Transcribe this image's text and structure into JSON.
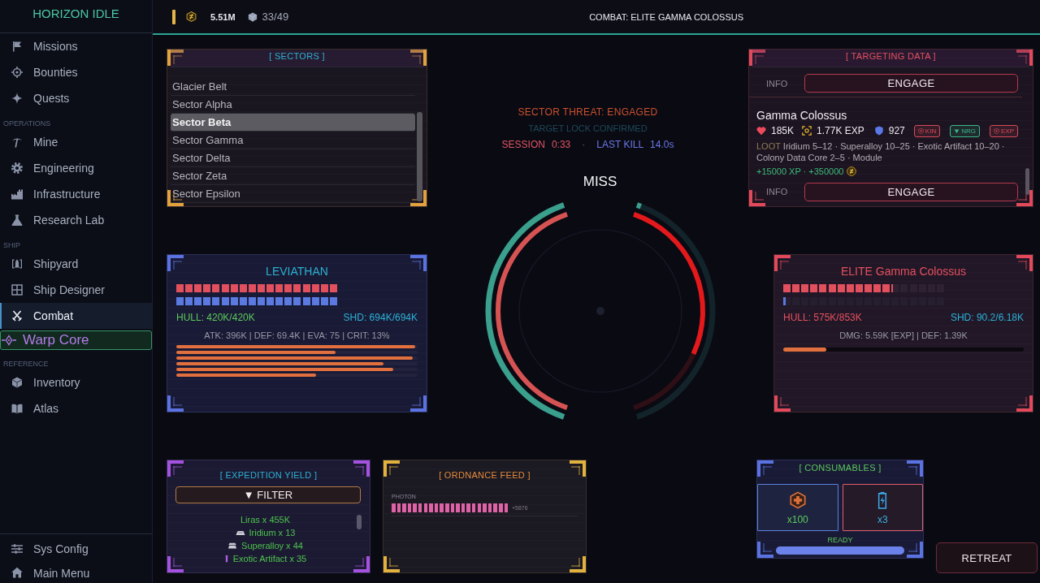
{
  "sidebar": {
    "title": "HORIZON IDLE",
    "sections": [
      {
        "items": [
          {
            "label": "Missions",
            "kind": "nav",
            "selected": false
          },
          {
            "label": "Bounties",
            "kind": "nav",
            "selected": false
          },
          {
            "label": "Quests",
            "kind": "nav",
            "selected": false
          }
        ]
      },
      {
        "heading": "OPERATIONS",
        "items": [
          {
            "label": "Mine",
            "kind": "nav",
            "selected": false
          },
          {
            "label": "Engineering",
            "kind": "nav",
            "selected": false
          },
          {
            "label": "Infrastructure",
            "kind": "nav",
            "selected": false
          },
          {
            "label": "Research Lab",
            "kind": "nav",
            "selected": false
          }
        ]
      },
      {
        "heading": "SHIP",
        "items": [
          {
            "label": "Shipyard",
            "kind": "nav",
            "selected": false
          },
          {
            "label": "Ship Designer",
            "kind": "nav",
            "selected": false
          },
          {
            "label": "Combat",
            "kind": "nav",
            "selected": true
          },
          {
            "label": "Warp Core",
            "kind": "featured",
            "selected": false
          }
        ]
      },
      {
        "heading": "REFERENCE",
        "items": [
          {
            "label": "Inventory",
            "kind": "nav",
            "selected": false
          },
          {
            "label": "Atlas",
            "kind": "nav",
            "selected": false
          }
        ]
      }
    ],
    "footer": [
      {
        "label": "Sys Config",
        "selected": false
      },
      {
        "label": "Main Menu",
        "selected": false
      }
    ]
  },
  "topbar": {
    "credits": "5.51M",
    "cargo": "33/49",
    "title": "COMBAT: ELITE GAMMA COLOSSUS"
  },
  "sectors": {
    "title": "[ SECTORS ]",
    "items": [
      {
        "label": "Glacier Belt",
        "selected": false
      },
      {
        "label": "Sector Alpha",
        "selected": false
      },
      {
        "label": "Sector Beta",
        "selected": true
      },
      {
        "label": "Sector Gamma",
        "selected": false
      },
      {
        "label": "Sector Delta",
        "selected": false
      },
      {
        "label": "Sector Zeta",
        "selected": false
      },
      {
        "label": "Sector Epsilon",
        "selected": false
      }
    ]
  },
  "status": {
    "threat": "SECTOR THREAT: ENGAGED",
    "lock": "TARGET LOCK CONFIRMED",
    "stats": [
      {
        "label": "SESSION",
        "value": "0:33",
        "color": "#e05565"
      },
      {
        "label": "LAST KILL",
        "value": "14.0s",
        "color": "#6a78e6"
      }
    ],
    "separator": "·",
    "result": "MISS"
  },
  "targeting": {
    "title": "[ TARGETING DATA ]",
    "rows": [
      {
        "kind": "actions",
        "info": "INFO",
        "button": "ENGAGE"
      },
      {
        "kind": "target",
        "name": "Gamma Colossus",
        "hp": "185K",
        "exp": "1.77K EXP",
        "armor": "927",
        "tags": [
          {
            "label": "KIN",
            "kind": "resist",
            "color": "#d84a5a"
          },
          {
            "label": "NRG",
            "kind": "weak",
            "color": "#3ab88a"
          },
          {
            "label": "EXP",
            "kind": "resist",
            "color": "#d84a5a"
          }
        ],
        "loot_label": "LOOT",
        "loot": "Iridium 5–12 · Superalloy 10–25 · Exotic Artifact 10–20 · Colony Data Core 2–5 · Module",
        "rewards": "+15000 XP · +350000"
      },
      {
        "kind": "actions",
        "info": "INFO",
        "button": "ENGAGE"
      }
    ]
  },
  "player": {
    "name": "LEVIATHAN",
    "hull": {
      "level": 1,
      "text": "HULL: 420K/420K"
    },
    "shield": {
      "level": 1,
      "text": "SHD: 694K/694K"
    },
    "stats": "ATK: 396K | DEF: 69.4K | EVA: 75 | CRIT: 13%",
    "weapons": [
      {
        "level": 0.99
      },
      {
        "level": 0.66
      },
      {
        "level": 0.98
      },
      {
        "level": 0.86
      },
      {
        "level": 0.9
      },
      {
        "level": 0.58
      }
    ]
  },
  "rings": {
    "left": {
      "shield": {
        "level": 1
      },
      "hull": {
        "level": 1
      }
    },
    "right": {
      "hull": {
        "level": 0.674
      },
      "shield": {
        "level": 0.015
      }
    }
  },
  "enemy": {
    "name": "ELITE Gamma Colossus",
    "hull": {
      "level": 0.674,
      "text": "HULL: 575K/853K"
    },
    "shield": {
      "level": 0.015,
      "text": "SHD: 90.2/6.18K"
    },
    "stats": "DMG: 5.59K [EXP] | DEF: 1.39K",
    "charge": {
      "level": 0.18
    }
  },
  "expedition": {
    "title": "[ EXPEDITION YIELD ]",
    "filter": "▼ FILTER",
    "items": [
      {
        "label": "Liras x 455K",
        "kind": "currency"
      },
      {
        "label": "Iridium x 13",
        "kind": "metal"
      },
      {
        "label": "Superalloy x 44",
        "kind": "alloy"
      },
      {
        "label": "Exotic Artifact x 35",
        "kind": "artifact"
      }
    ]
  },
  "ordnance": {
    "title": "[ ORDNANCE FEED ]",
    "feeds": [
      {
        "label": "PHOTON",
        "count": "+5876"
      }
    ]
  },
  "consumables": {
    "title": "[ CONSUMABLES ]",
    "slots": [
      {
        "kind": "repair",
        "count": "x100",
        "color": "#5a80e0"
      },
      {
        "kind": "energy",
        "count": "x3",
        "color": "#e06070"
      }
    ],
    "status": "READY",
    "ready": {
      "level": 1
    }
  },
  "retreat": "RETREAT"
}
